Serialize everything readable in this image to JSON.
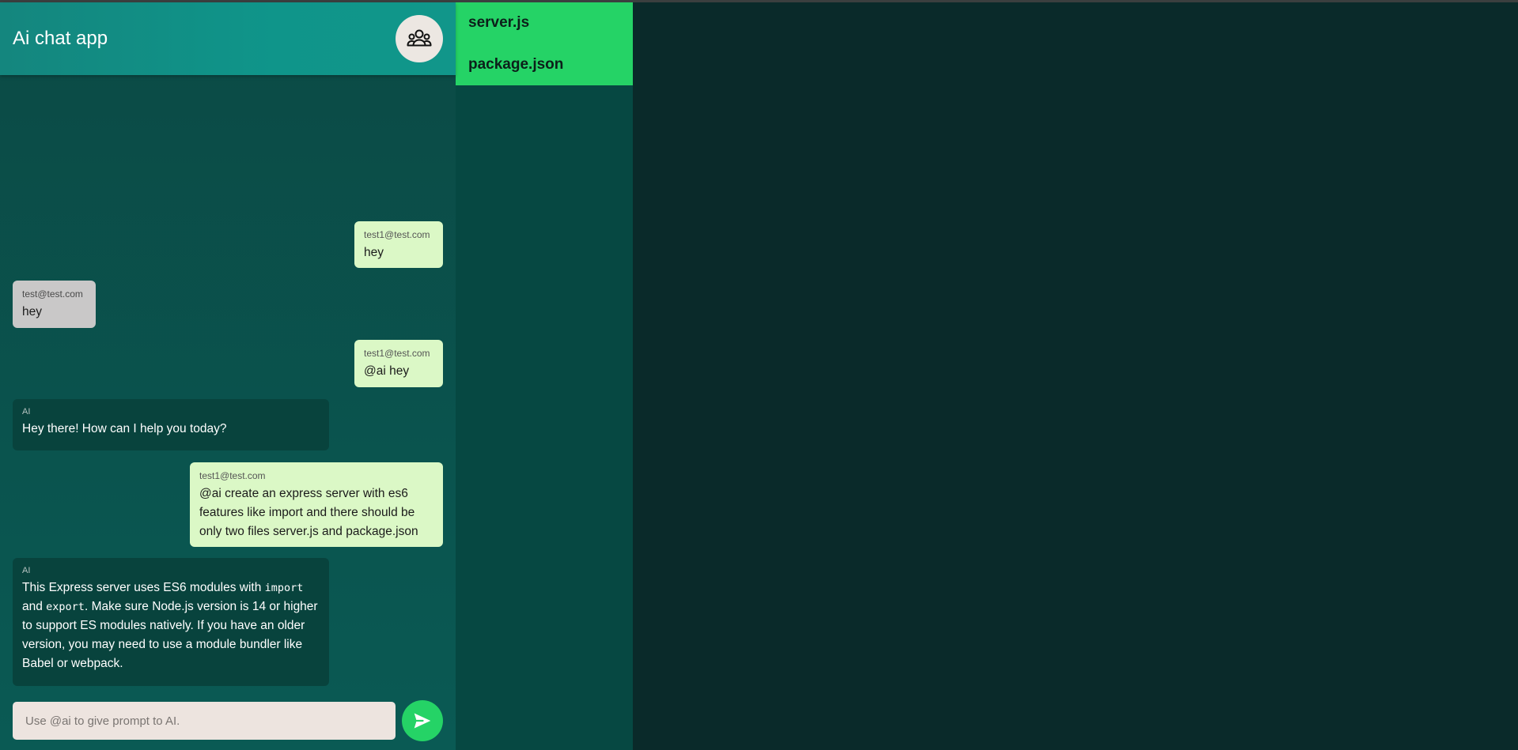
{
  "header": {
    "title": "Ai chat app",
    "collaborators_icon": "users-group-icon"
  },
  "messages": [
    {
      "sender": "test1@test.com",
      "text": "hey",
      "kind": "mine"
    },
    {
      "sender": "test@test.com",
      "text": "hey",
      "kind": "other"
    },
    {
      "sender": "test1@test.com",
      "text": "@ai hey",
      "kind": "mine"
    },
    {
      "sender": "AI",
      "text": "Hey there! How can I help you today?",
      "kind": "ai"
    },
    {
      "sender": "test1@test.com",
      "text": "@ai create an express server with es6 features like import and there should be only two files server.js and package.json",
      "kind": "mine"
    },
    {
      "sender": "AI",
      "kind": "ai",
      "parts": {
        "p1": "This Express server uses ES6 modules with ",
        "code1": "import",
        "p2": " and ",
        "code2": "export",
        "p3": ". Make sure Node.js version is 14 or higher to support ES modules natively. If you have an older version, you may need to use a module bundler like Babel or webpack."
      }
    }
  ],
  "input": {
    "placeholder": "Use @ai to give prompt to AI.",
    "value": ""
  },
  "send_icon": "send-icon",
  "files": [
    {
      "name": "server.js"
    },
    {
      "name": "package.json"
    }
  ],
  "colors": {
    "header": "#14867e",
    "accent": "#25d366",
    "mine_bubble": "#dbf8c6",
    "ai_bubble": "#08433d",
    "other_bubble": "#c9c8c8",
    "editor_bg": "#0a2a2a"
  }
}
